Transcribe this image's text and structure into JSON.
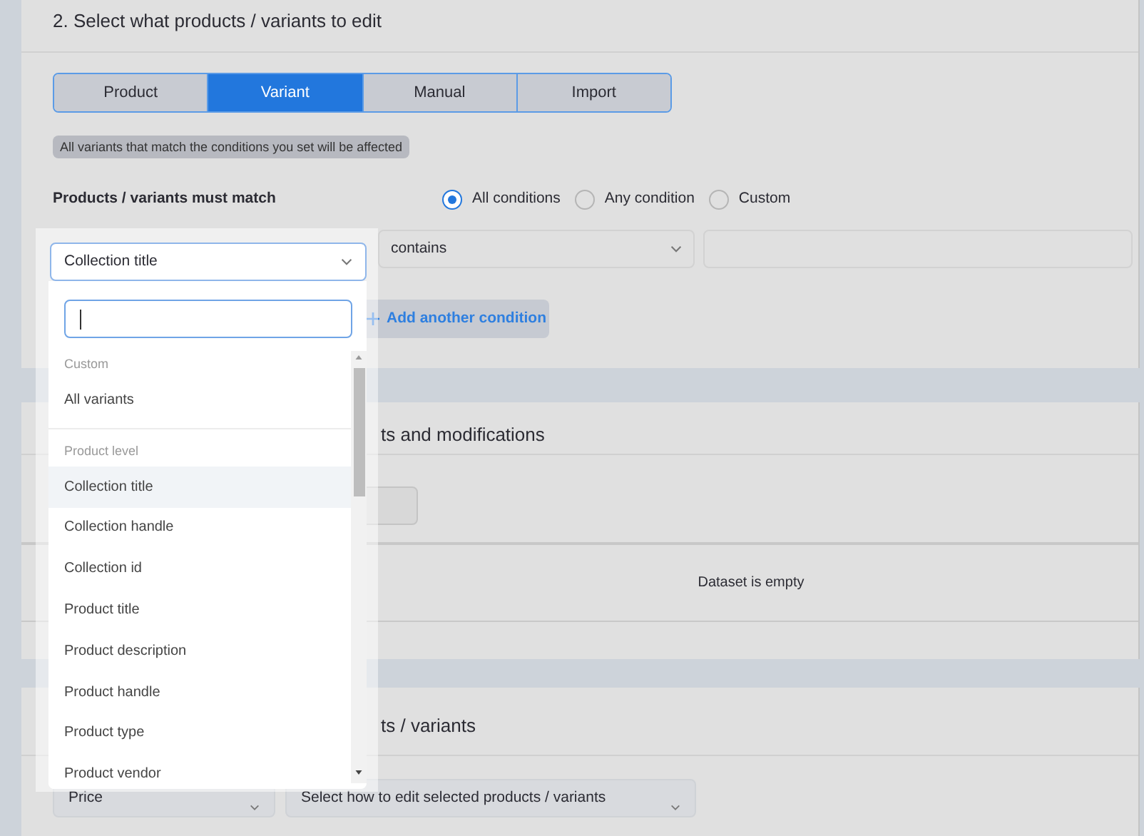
{
  "section_select": {
    "title": "2. Select what products / variants to edit",
    "tabs": [
      {
        "label": "Product",
        "selected": false
      },
      {
        "label": "Variant",
        "selected": true
      },
      {
        "label": "Manual",
        "selected": false
      },
      {
        "label": "Import",
        "selected": false
      }
    ],
    "info": "All variants that match the conditions you set will be affected",
    "match_label": "Products / variants must match",
    "match_options": [
      {
        "label": "All conditions",
        "selected": true
      },
      {
        "label": "Any condition",
        "selected": false
      },
      {
        "label": "Custom",
        "selected": false
      }
    ],
    "operator": "contains",
    "add_button": "Add another condition"
  },
  "section_preview": {
    "title": "ts and modifications",
    "empty_message": "Dataset is empty"
  },
  "section_edit": {
    "title": "ts / variants",
    "field": "Price",
    "action_placeholder": "Select how to edit selected products / variants"
  },
  "dropdown": {
    "value": "Collection title",
    "groups": [
      {
        "label": "Custom",
        "items": [
          {
            "label": "All variants",
            "selected": false
          }
        ]
      },
      {
        "label": "Product level",
        "items": [
          {
            "label": "Collection title",
            "selected": true
          },
          {
            "label": "Collection handle",
            "selected": false
          },
          {
            "label": "Collection id",
            "selected": false
          },
          {
            "label": "Product title",
            "selected": false
          },
          {
            "label": "Product description",
            "selected": false
          },
          {
            "label": "Product handle",
            "selected": false
          },
          {
            "label": "Product type",
            "selected": false
          },
          {
            "label": "Product vendor",
            "selected": false
          }
        ]
      }
    ]
  }
}
